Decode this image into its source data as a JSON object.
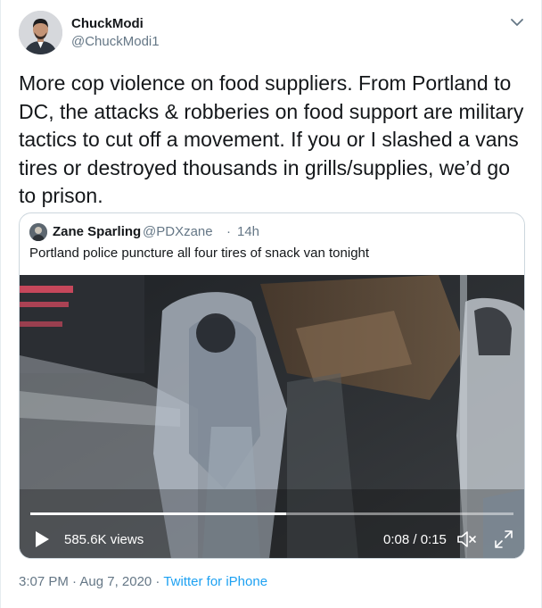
{
  "author": {
    "display_name": "ChuckModi",
    "handle": "@ChuckModi1",
    "avatar_icon": "profile-photo"
  },
  "tweet": {
    "text": "More cop violence on food suppliers. From Portland to DC, the attacks & robberies on food support are military tactics to cut off a movement. If you or I slashed a vans tires or destroyed thousands in grills/supplies, we’d go to prison."
  },
  "quoted_tweet": {
    "display_name": "Zane Sparling",
    "handle": "@PDXzane",
    "separator": "·",
    "time": "14h",
    "text": "Portland police puncture all four tires of snack van tonight",
    "video": {
      "views": "585.6K views",
      "time_readout": "0:08 / 0:15",
      "progress_fraction": 0.53
    }
  },
  "meta": {
    "timestamp": "3:07 PM · Aug 7, 2020 · ",
    "source": "Twitter for iPhone"
  },
  "colors": {
    "text": "#14171a",
    "secondary": "#657786",
    "link": "#1da1f2",
    "border": "#ccd6dd"
  }
}
